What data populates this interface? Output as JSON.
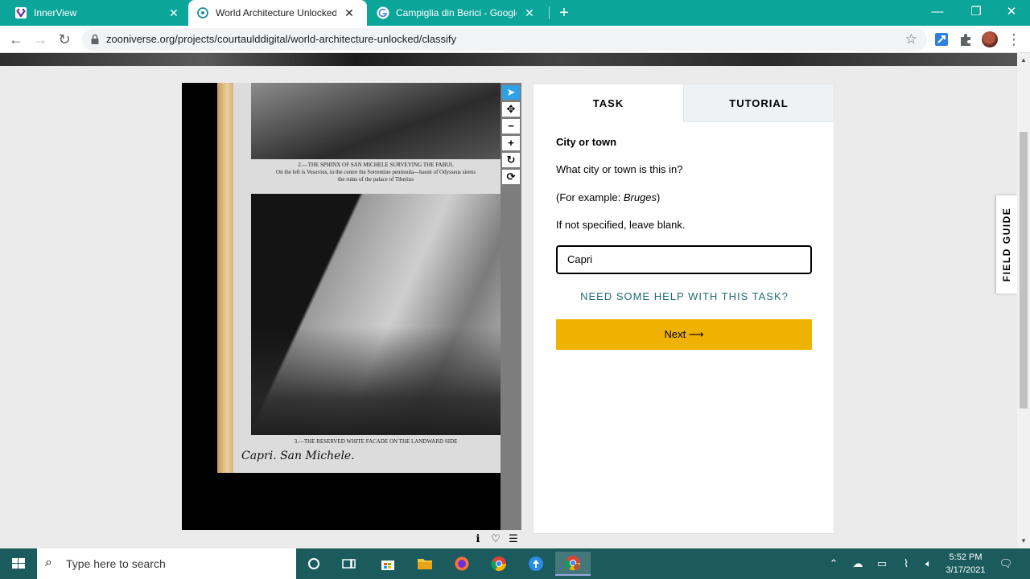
{
  "browser": {
    "tabs": [
      {
        "label": "InnerView",
        "icon": "innerview-icon"
      },
      {
        "label": "World Architecture Unlocked » C",
        "icon": "zooniverse-icon"
      },
      {
        "label": "Campiglia din Berici - Google Se",
        "icon": "google-icon"
      }
    ],
    "url": "zooniverse.org/projects/courtaulddigital/world-architecture-unlocked/classify"
  },
  "subject": {
    "caption_top_line1": "2.—THE SPHINX OF SAN MICHELE SURVEYING THE FABUL",
    "caption_top_line2": "On the left is Vesuvius, in the centre the Sorrentine peninsula—haunt of Odysseus sirens",
    "caption_top_line3": "the ruins of the palace of Tiberius",
    "caption_bottom": "3.—THE RESERVED WHITE FACADE ON THE LANDWARD SIDE",
    "handwriting": "Capri.   San Michele."
  },
  "task": {
    "tab_task": "TASK",
    "tab_tutorial": "TUTORIAL",
    "question_title": "City or town",
    "question": "What city or town is this in?",
    "example_prefix": "(For example: ",
    "example_value": "Bruges",
    "example_suffix": ")",
    "instruction": "If not specified, leave blank.",
    "answer_value": "Capri",
    "help_link": "NEED SOME HELP WITH THIS TASK?",
    "next_label": "Next ⟶"
  },
  "field_guide": "FIELD GUIDE",
  "taskbar": {
    "search_placeholder": "Type here to search",
    "time": "5:52 PM",
    "date": "3/17/2021"
  },
  "colors": {
    "tab_strip": "#0ca59a",
    "next_button": "#f0b200",
    "help_link": "#1d6d7a",
    "taskbar": "#1b5b5e",
    "tool_selected": "#2da1e3"
  }
}
